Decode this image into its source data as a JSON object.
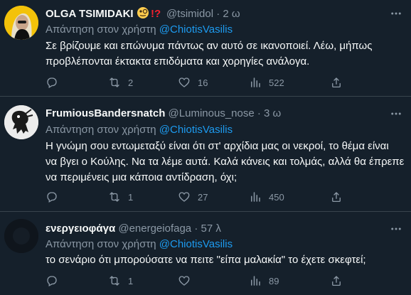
{
  "tweets": [
    {
      "name": "OLGA TSIMIDAKI",
      "badges": "🧐⁉️",
      "handle": "@tsimidol",
      "dot": "·",
      "time": "2 ω",
      "reply_prefix": "Απάντηση στον χρήστη",
      "reply_mention": "@ChiotisVasilis",
      "text_lines": [
        "Σε βρίζουμε και επώνυμα πάντως αν αυτό σε ικανοποιεί.  Λέω, μήπως",
        "προβλέπονται έκτακτα επιδόματα και χορηγίες ανάλογα."
      ],
      "replies": "",
      "retweets": "2",
      "likes": "16",
      "views": "522"
    },
    {
      "name": "FrumiousBandersnatch",
      "handle": "@Luminous_nose",
      "dot": "·",
      "time": "3 ω",
      "reply_prefix": "Απάντηση στον χρήστη",
      "reply_mention": "@ChiotisVasilis",
      "text_lines": [
        "Η γνώμη σου εντωμεταξύ είναι ότι στ' αρχίδια μας οι νεκροί, το θέμα είναι",
        "να βγει ο Κούλης. Να τα λέμε αυτά. Καλά κάνεις και τολμάς, αλλά θα έπρεπε",
        "να περιμένεις μια κάποια αντίδραση, όχι;"
      ],
      "replies": "",
      "retweets": "1",
      "likes": "27",
      "views": "450"
    },
    {
      "name": "ενεργειοφάγα",
      "handle": "@energeiofaga",
      "dot": "·",
      "time": "57 λ",
      "reply_prefix": "Απάντηση στον χρήστη",
      "reply_mention": "@ChiotisVasilis",
      "text_lines": [
        "το σενάριο ότι μπορούσατε να πειτε \"είπα μαλακία\" το έχετε σκεφτεί;"
      ],
      "replies": "",
      "retweets": "1",
      "likes": "",
      "views": "89"
    }
  ],
  "colors": {
    "background": "#15202b",
    "text": "#f7f9f9",
    "secondary": "#8b98a5",
    "link": "#1d9bf0",
    "divider": "#38444d"
  }
}
